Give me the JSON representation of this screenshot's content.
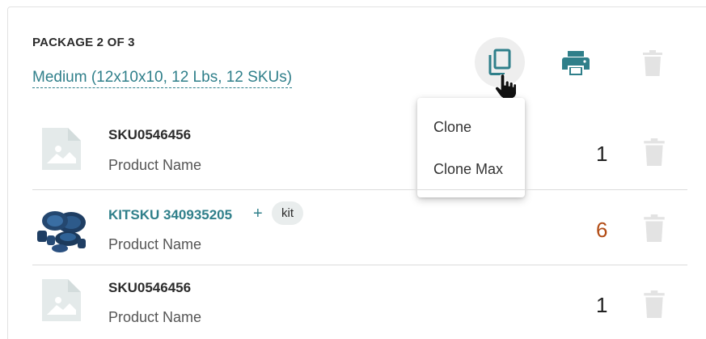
{
  "package": {
    "title": "PACKAGE 2 OF 3",
    "size_label": "Medium (12x10x10, 12 Lbs, 12 SKUs)"
  },
  "toolbar": {
    "clone_icon": "copy-icon",
    "print_icon": "printer-icon",
    "delete_icon": "trash-icon"
  },
  "clone_menu": {
    "items": [
      "Clone",
      "Clone Max"
    ]
  },
  "items": [
    {
      "sku": "SKU0546456",
      "name": "Product Name",
      "qty": "1",
      "thumb": "image-placeholder-icon"
    },
    {
      "sku": "KITSKU 340935205",
      "plus": "+",
      "badge": "kit",
      "name": "Product Name",
      "qty": "6",
      "thumb": "product-photo"
    },
    {
      "sku": "SKU0546456",
      "name": "Product Name",
      "qty": "1",
      "thumb": "image-placeholder-icon"
    }
  ],
  "colors": {
    "link": "#2f7f8a",
    "qty_highlight": "#b24c15",
    "icon_muted": "#e3e3e3",
    "icon_active": "#2f7f8a",
    "placeholder": "#e4eaea"
  }
}
